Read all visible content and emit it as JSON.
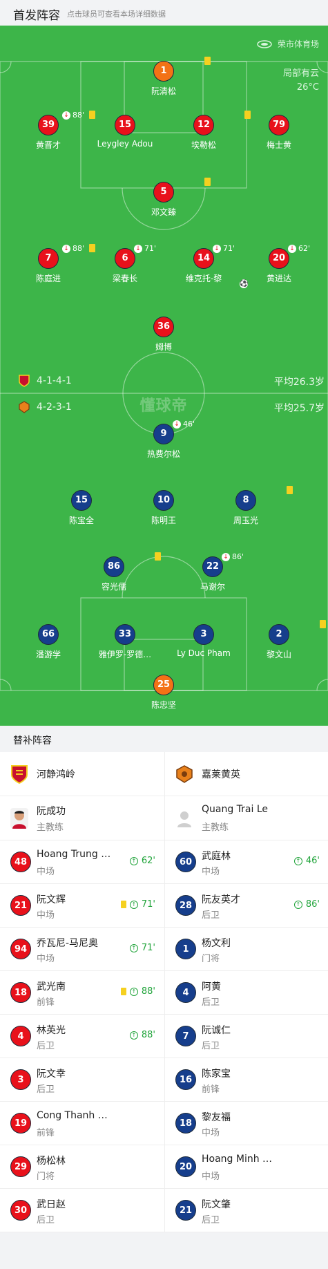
{
  "header": {
    "title": "首发阵容",
    "subtitle": "点击球员可查看本场详细数据"
  },
  "pitch": {
    "venue": "荣市体育场",
    "weather": "局部有云",
    "temperature": "26°C",
    "watermark": "懂球帝",
    "home": {
      "formation": "4-1-4-1",
      "avg_age": "平均26.3岁"
    },
    "away": {
      "formation": "4-2-3-1",
      "avg_age": "平均25.7岁"
    }
  },
  "home_players": [
    {
      "num": "1",
      "name": "阮清松",
      "kit": "gk",
      "yellow": true
    },
    {
      "num": "39",
      "name": "黄晋才",
      "kit": "red",
      "yellow": true,
      "sub_off": "88'"
    },
    {
      "num": "15",
      "name": "Leygley Adou",
      "kit": "red"
    },
    {
      "num": "12",
      "name": "埃勒松",
      "kit": "red",
      "yellow": true
    },
    {
      "num": "79",
      "name": "梅士黄",
      "kit": "red"
    },
    {
      "num": "5",
      "name": "邓文臻",
      "kit": "red",
      "yellow": true
    },
    {
      "num": "7",
      "name": "陈庭进",
      "kit": "red",
      "yellow": true,
      "sub_off": "88'"
    },
    {
      "num": "6",
      "name": "梁春长",
      "kit": "red",
      "sub_off": "71'"
    },
    {
      "num": "14",
      "name": "维克托-黎",
      "kit": "red",
      "sub_off": "71'",
      "goal": true
    },
    {
      "num": "20",
      "name": "黄进达",
      "kit": "red",
      "sub_off": "62'"
    },
    {
      "num": "36",
      "name": "姆博",
      "kit": "red"
    }
  ],
  "away_players": [
    {
      "num": "9",
      "name": "热费尔松",
      "kit": "blue",
      "sub_off": "46'"
    },
    {
      "num": "15",
      "name": "陈宝全",
      "kit": "blue"
    },
    {
      "num": "10",
      "name": "陈明王",
      "kit": "blue"
    },
    {
      "num": "8",
      "name": "周玉光",
      "kit": "blue",
      "yellow": true
    },
    {
      "num": "86",
      "name": "容光儒",
      "kit": "blue",
      "yellow": true
    },
    {
      "num": "22",
      "name": "马谢尔",
      "kit": "blue",
      "sub_off": "86'"
    },
    {
      "num": "66",
      "name": "潘游学",
      "kit": "blue"
    },
    {
      "num": "33",
      "name": "雅伊罗-罗德…",
      "kit": "blue"
    },
    {
      "num": "3",
      "name": "Ly Duc Pham",
      "kit": "blue"
    },
    {
      "num": "2",
      "name": "黎文山",
      "kit": "blue",
      "yellow": true
    },
    {
      "num": "25",
      "name": "陈忠坚",
      "kit": "gk"
    }
  ],
  "subs": {
    "title": "替补阵容",
    "home_team": "河静鸿岭",
    "away_team": "嘉莱黄英",
    "home_coach": {
      "name": "阮成功",
      "role": "主教练"
    },
    "away_coach": {
      "name": "Quang Trai Le",
      "role": "主教练"
    },
    "home": [
      {
        "num": "48",
        "name": "Hoang Trung …",
        "pos": "中场",
        "sub_on": "62'"
      },
      {
        "num": "21",
        "name": "阮文辉",
        "pos": "中场",
        "yellow": true,
        "sub_on": "71'"
      },
      {
        "num": "94",
        "name": "乔瓦尼-马尼奥",
        "pos": "中场",
        "sub_on": "71'"
      },
      {
        "num": "18",
        "name": "武光南",
        "pos": "前锋",
        "yellow": true,
        "sub_on": "88'"
      },
      {
        "num": "4",
        "name": "林英光",
        "pos": "后卫",
        "sub_on": "88'"
      },
      {
        "num": "3",
        "name": "阮文幸",
        "pos": "后卫"
      },
      {
        "num": "19",
        "name": "Cong Thanh …",
        "pos": "前锋"
      },
      {
        "num": "29",
        "name": "杨松林",
        "pos": "门将"
      },
      {
        "num": "30",
        "name": "武日赵",
        "pos": "后卫"
      }
    ],
    "away": [
      {
        "num": "60",
        "name": "武庭林",
        "pos": "中场",
        "sub_on": "46'"
      },
      {
        "num": "28",
        "name": "阮友英才",
        "pos": "后卫",
        "sub_on": "86'"
      },
      {
        "num": "1",
        "name": "杨文利",
        "pos": "门将"
      },
      {
        "num": "4",
        "name": "阿黄",
        "pos": "后卫"
      },
      {
        "num": "7",
        "name": "阮诚仁",
        "pos": "后卫"
      },
      {
        "num": "16",
        "name": "陈家宝",
        "pos": "前锋"
      },
      {
        "num": "18",
        "name": "黎友福",
        "pos": "中场"
      },
      {
        "num": "20",
        "name": "Hoang Minh …",
        "pos": "中场"
      },
      {
        "num": "21",
        "name": "阮文肇",
        "pos": "后卫"
      }
    ]
  },
  "colors": {
    "pitch": "#3db549",
    "home_kit": "#e8111b",
    "away_kit": "#163e8c",
    "gk_kit": "#f37216",
    "sub_green": "#21a43b",
    "yellow_card": "#f5d020"
  }
}
